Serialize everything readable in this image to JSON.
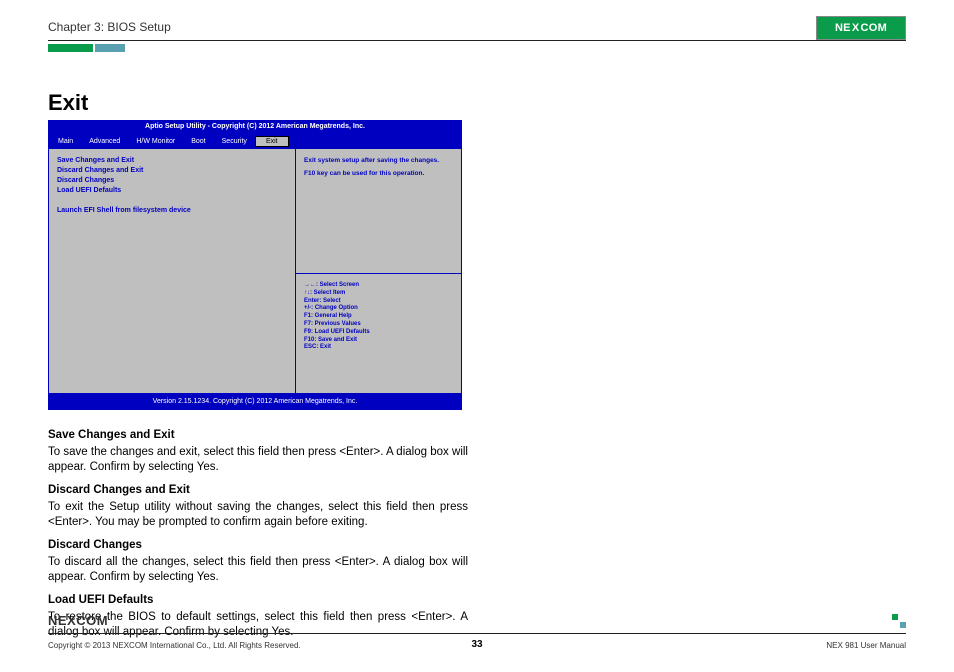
{
  "header": {
    "chapter": "Chapter 3: BIOS Setup"
  },
  "logo": {
    "text": "NEXCOM",
    "text_btm": "NEXCOM"
  },
  "title": "Exit",
  "bios": {
    "titlebar": "Aptio Setup Utility - Copyright (C) 2012 American Megatrends, Inc.",
    "tabs": [
      "Main",
      "Advanced",
      "H/W Monitor",
      "Boot",
      "Security",
      "Exit"
    ],
    "active_tab": "Exit",
    "items": [
      "Save Changes and Exit",
      "Discard Changes and Exit",
      "Discard Changes",
      "Load UEFI Defaults"
    ],
    "extra_item": "Launch EFI Shell from filesystem device",
    "help_top_1": "Exit system setup after saving the changes.",
    "help_top_2": "F10 key can be used for this operation.",
    "keys": [
      "→←: Select Screen",
      "↑↓: Select Item",
      "Enter: Select",
      "+/-: Change Option",
      "F1: General Help",
      "F7: Previous Values",
      "F9: Load UEFI Defaults",
      "F10: Save and Exit",
      "ESC: Exit"
    ],
    "footer": "Version 2.15.1234. Copyright (C) 2012 American Megatrends, Inc."
  },
  "sections": {
    "s1_h": "Save Changes and Exit",
    "s1_p": "To save the changes and exit, select this field then press <Enter>. A dialog box will appear. Confirm by selecting Yes.",
    "s2_h": "Discard Changes and Exit",
    "s2_p": "To exit the Setup utility without saving the changes, select this field then press <Enter>. You may be prompted to confirm again before exiting.",
    "s3_h": "Discard Changes",
    "s3_p": "To discard all the changes, select this field then press <Enter>. A dialog box will appear. Confirm by selecting Yes.",
    "s4_h": "Load UEFI Defaults",
    "s4_p": "To restore the BIOS to default settings, select this field then press <Enter>. A dialog box will appear. Confirm by selecting Yes."
  },
  "footer": {
    "copyright": "Copyright © 2013 NEXCOM International Co., Ltd. All Rights Reserved.",
    "page": "33",
    "manual": "NEX 981 User Manual"
  }
}
